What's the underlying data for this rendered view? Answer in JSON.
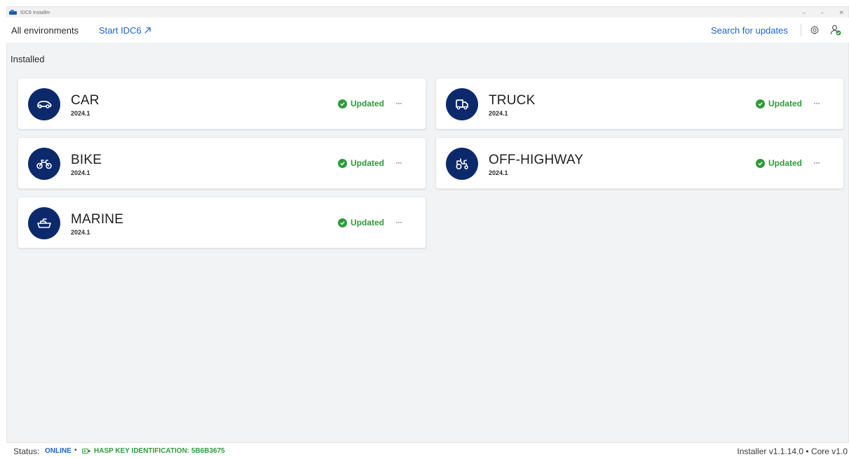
{
  "window": {
    "title": "IDC6 Installer",
    "controls": [
      "–",
      "▫",
      "✕"
    ]
  },
  "header": {
    "nav_all": "All environments",
    "nav_start": "Start IDC6",
    "search_updates": "Search for updates",
    "icons": [
      "gear-icon",
      "user-check-icon"
    ]
  },
  "main": {
    "section_title": "Installed",
    "cards": [
      {
        "name": "CAR",
        "version": "2024.1",
        "status": "Updated",
        "icon": "car-icon"
      },
      {
        "name": "TRUCK",
        "version": "2024.1",
        "status": "Updated",
        "icon": "truck-icon"
      },
      {
        "name": "BIKE",
        "version": "2024.1",
        "status": "Updated",
        "icon": "motorbike-icon"
      },
      {
        "name": "OFF-HIGHWAY",
        "version": "2024.1",
        "status": "Updated",
        "icon": "tractor-icon"
      },
      {
        "name": "MARINE",
        "version": "2024.1",
        "status": "Updated",
        "icon": "boat-icon"
      }
    ],
    "more_label": "···"
  },
  "statusbar": {
    "label": "Status:",
    "online": "ONLINE",
    "separator": "•",
    "hasp": "HASP KEY IDENTIFICATION: 5B6B3675",
    "version": "Installer v1.1.14.0 • Core v1.0"
  },
  "colors": {
    "accent": "#1f63c7",
    "icon_bg": "#0c2a6b",
    "success": "#2e9a3a"
  }
}
